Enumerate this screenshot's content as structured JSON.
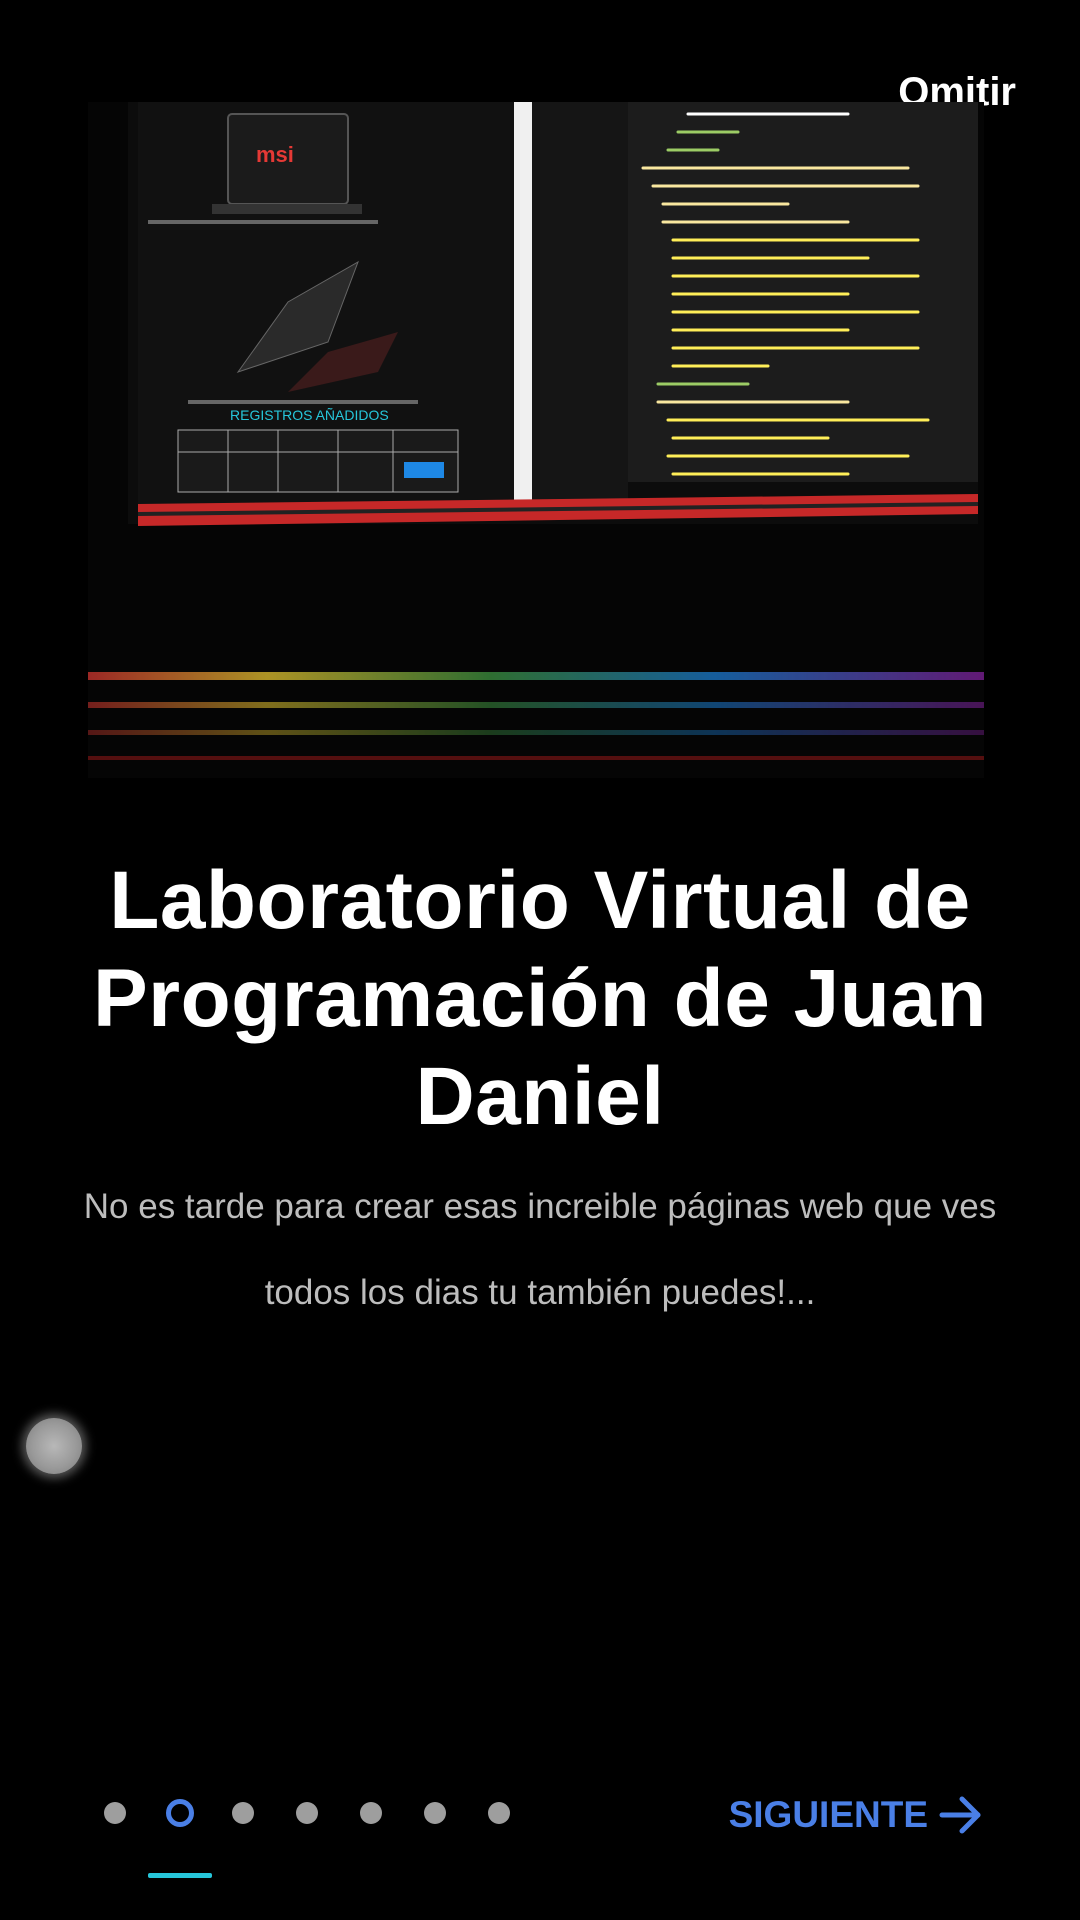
{
  "header": {
    "skip_label": "Omitir"
  },
  "hero": {
    "image_description_icon": "laptop-photo"
  },
  "content": {
    "title": "Laboratorio Virtual de Programación de Juan Daniel",
    "subtitle": "No es tarde para crear esas increible páginas web que ves todos los dias tu también puedes!..."
  },
  "footer": {
    "page_count": 7,
    "current_page": 2,
    "next_label": "SIGUIENTE",
    "next_icon": "arrow-right-icon"
  },
  "colors": {
    "background": "#000000",
    "accent": "#4a7fe6",
    "indicator": "#26c6da",
    "subtitle": "#bdbdbd"
  }
}
